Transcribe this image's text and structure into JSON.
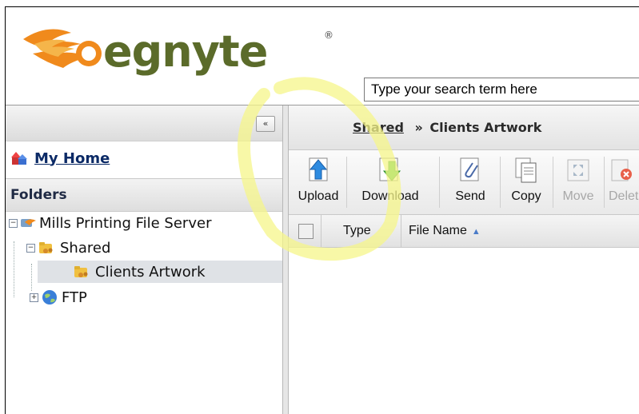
{
  "brand": {
    "name": "egnyte",
    "registered_mark": "®"
  },
  "search": {
    "placeholder": "Type your search term here"
  },
  "sidebar": {
    "collapse_symbol": "«",
    "my_home_label": "My Home",
    "folders_label": "Folders",
    "tree": [
      {
        "label": "Mills Printing File Server",
        "expand": "−",
        "icon": "server-icon"
      },
      {
        "label": "Shared",
        "expand": "−",
        "icon": "shared-folder-icon"
      },
      {
        "label": "Clients Artwork",
        "icon": "shared-folder-icon",
        "selected": true
      },
      {
        "label": "FTP",
        "expand": "+",
        "icon": "globe-icon"
      }
    ]
  },
  "breadcrumb": {
    "root": "Shared",
    "separator": "»",
    "current": "Clients Artwork"
  },
  "toolbar": {
    "upload": "Upload",
    "download": "Download",
    "send": "Send",
    "copy": "Copy",
    "move": "Move",
    "delete": "Delet"
  },
  "grid": {
    "col_type": "Type",
    "col_file_name": "File Name",
    "sort_symbol": "▲"
  },
  "colors": {
    "highlight": "#f6f58a",
    "link": "#0b2a66",
    "logo_flame": "#f08a1c",
    "logo_text": "#5b6b2a"
  }
}
